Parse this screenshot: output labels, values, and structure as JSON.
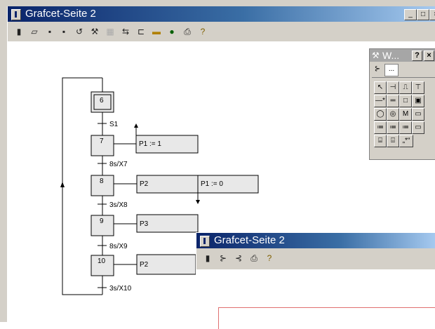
{
  "main_window": {
    "title": "Grafcet-Seite 2",
    "buttons": [
      "_",
      "□",
      "×"
    ],
    "toolbar_icons": [
      "new-icon",
      "open-icon",
      "save-icon",
      "save-as-icon",
      "undo-icon",
      "tools-icon",
      "grid-icon",
      "connect-icon",
      "layout-icon",
      "bus-icon",
      "traffic-light-icon",
      "print-icon",
      "help-icon"
    ]
  },
  "grafcet": {
    "steps": [
      "6",
      "7",
      "8",
      "9",
      "10"
    ],
    "transitions": [
      "S1",
      "8s/X7",
      "3s/X8",
      "8s/X9",
      "3s/X10"
    ],
    "actions": [
      "P1 := 1",
      "P2",
      "P1 := 0",
      "P3",
      "P2"
    ]
  },
  "palette": {
    "title": "W...",
    "help": "?",
    "close": "×",
    "tabs": [
      "",
      "..."
    ],
    "tools": [
      "↖",
      "⊣",
      "⎍",
      "⊤",
      "—*",
      "═",
      "□",
      "▣",
      "◯",
      "◎",
      "M",
      "▭",
      "≔",
      "≔",
      "≔",
      "▭",
      "⌸",
      "⌹",
      "„*“"
    ]
  },
  "second_window": {
    "title": "Grafcet-Seite 2",
    "toolbar_icons": [
      "new-icon",
      "tree-icon",
      "list-icon",
      "print-icon",
      "help-icon"
    ]
  }
}
